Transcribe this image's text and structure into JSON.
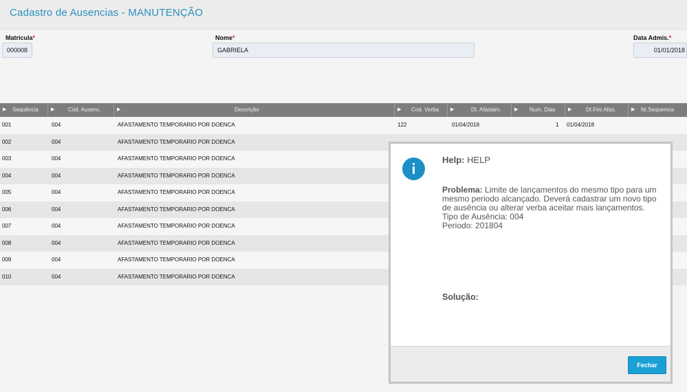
{
  "window": {
    "title": "Cadastro de Ausencias - MANUTENÇÃO"
  },
  "form": {
    "matricula": {
      "label": "Matricula",
      "required_mark": "*",
      "value": "000008"
    },
    "nome": {
      "label": "Nome",
      "required_mark": "*",
      "value": "GABRIELA"
    },
    "data_admis": {
      "label": "Data Admis.",
      "required_mark": "*",
      "value": "01/01/2018"
    }
  },
  "grid": {
    "columns": [
      "Sequência",
      "Cód. Ausenc.",
      "Descrição",
      "Cod. Verba",
      "Dt. Afastam.",
      "Num. Dias",
      "Dt.Fim Afas.",
      "Nr.Sequencia"
    ],
    "rows": [
      {
        "seq": "001",
        "cod": "004",
        "desc": "AFASTAMENTO TEMPORARIO POR DOENCA",
        "verba": "122",
        "dt_afast": "01/04/2018",
        "dias": "1",
        "dt_fim": "01/04/2018"
      },
      {
        "seq": "002",
        "cod": "004",
        "desc": "AFASTAMENTO TEMPORARIO POR DOENCA"
      },
      {
        "seq": "003",
        "cod": "004",
        "desc": "AFASTAMENTO TEMPORARIO POR DOENCA"
      },
      {
        "seq": "004",
        "cod": "004",
        "desc": "AFASTAMENTO TEMPORARIO POR DOENCA"
      },
      {
        "seq": "005",
        "cod": "004",
        "desc": "AFASTAMENTO TEMPORARIO POR DOENCA"
      },
      {
        "seq": "006",
        "cod": "004",
        "desc": "AFASTAMENTO TEMPORARIO POR DOENCA"
      },
      {
        "seq": "007",
        "cod": "004",
        "desc": "AFASTAMENTO TEMPORARIO POR DOENCA"
      },
      {
        "seq": "008",
        "cod": "004",
        "desc": "AFASTAMENTO TEMPORARIO POR DOENCA"
      },
      {
        "seq": "009",
        "cod": "004",
        "desc": "AFASTAMENTO TEMPORARIO POR DOENCA"
      },
      {
        "seq": "010",
        "cod": "004",
        "desc": "AFASTAMENTO TEMPORARIO POR DOENCA"
      }
    ]
  },
  "help_dialog": {
    "icon": "info-icon",
    "title_label": "Help:",
    "title_value": "HELP",
    "problem_label": "Problema:",
    "problem_text": "Limite de lançamentos do mesmo tipo para um mesmo periodo alcançado. Deverá cadastrar um novo tipo de ausência ou alterar verba aceitar mais lançamentos.",
    "problem_line_tipo": "Tipo de Ausência: 004",
    "problem_line_periodo": "Periodo: 201804",
    "solution_label": "Solução:",
    "close_label": "Fechar"
  },
  "colors": {
    "accent": "#1aa0d4",
    "title": "#2a8fbf",
    "header": "#7d7d7d"
  }
}
